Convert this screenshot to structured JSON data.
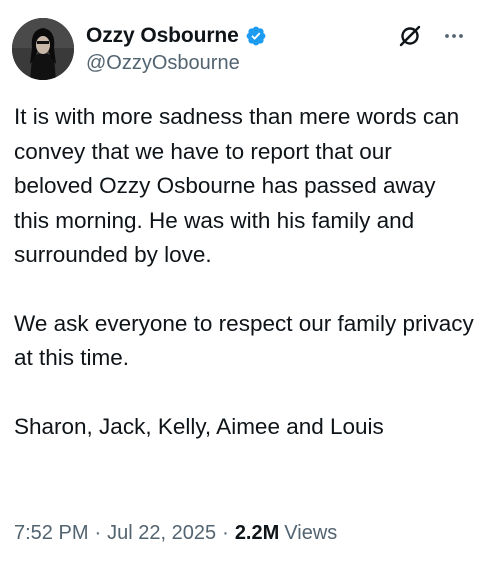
{
  "author": {
    "display_name": "Ozzy Osbourne",
    "handle": "@OzzyOsbourne",
    "verified": true,
    "verified_color": "#1d9bf0"
  },
  "actions": {
    "grok_icon": "grok-icon",
    "more_icon": "more-horizontal-icon"
  },
  "tweet": {
    "paragraphs": [
      "It is with more sadness than mere words can convey that we have to report that our beloved Ozzy Osbourne has passed away this morning. He was with his family and surrounded by love.",
      "We ask everyone to respect our family privacy at this time.",
      "Sharon, Jack, Kelly, Aimee and Louis"
    ]
  },
  "meta": {
    "time": "7:52 PM",
    "dot1": "·",
    "date": "Jul 22, 2025",
    "dot2": "·",
    "views_count": "2.2M",
    "views_label": "Views"
  },
  "colors": {
    "text_primary": "#0f1419",
    "text_secondary": "#536471"
  }
}
